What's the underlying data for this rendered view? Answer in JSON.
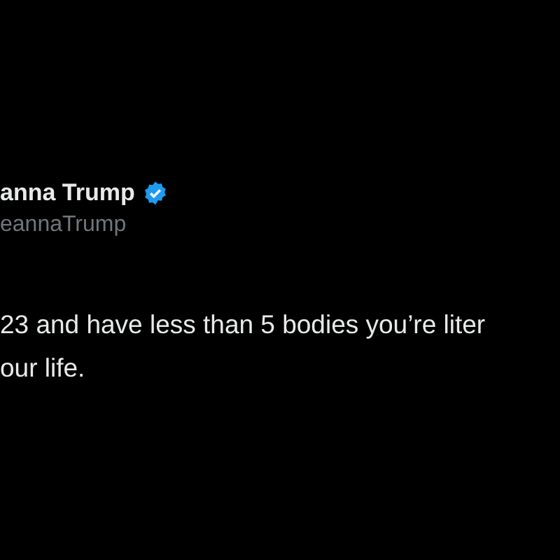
{
  "tweet": {
    "author_name": "anna Trump",
    "verified": true,
    "handle": "eannaTrump",
    "body_lines": [
      "23 and have less than 5 bodies you’re liter",
      "our life."
    ]
  }
}
